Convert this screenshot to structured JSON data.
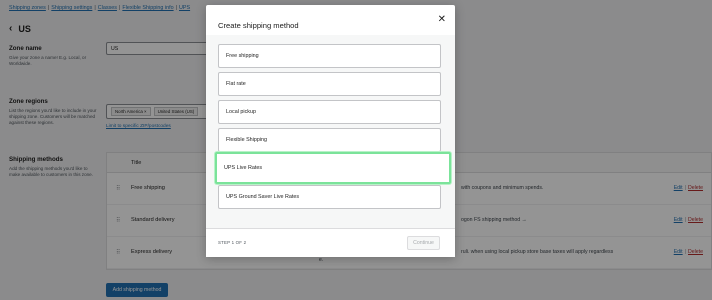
{
  "breadcrumb": {
    "items": [
      "Shipping zones",
      "Shipping settings",
      "Classes",
      "Flexible Shipping info",
      "UPS"
    ],
    "separator": "|"
  },
  "zone": {
    "back_title": "US",
    "name_section": {
      "title": "Zone name",
      "description": "Give your zone a name! E.g. Local, or Worldwide.",
      "value": "US"
    },
    "regions_section": {
      "title": "Zone regions",
      "description": "List the regions you'd like to include in your shipping zone. Customers will be matched against these regions.",
      "chips": [
        "North America ×",
        "United States (US)"
      ],
      "limit_link": "Limit to specific ZIP/postcodes"
    },
    "methods_section": {
      "title": "Shipping methods",
      "description": "Add the shipping methods you'd like to make available to customers in this zone.",
      "column_title": "Title",
      "rows": [
        {
          "name": "Free shipping",
          "desc": "with coupons and minimum spends.",
          "desc2": ""
        },
        {
          "name": "Standard delivery",
          "desc": "ogon FS shipping method →",
          "desc2": ""
        },
        {
          "name": "Express delivery",
          "desc": "ruli. when using local pickup store base taxes will apply regardless",
          "desc2": "e."
        }
      ],
      "edit_label": "Edit",
      "delete_label": "Delete",
      "add_button": "Add shipping method"
    }
  },
  "modal": {
    "title": "Create shipping method",
    "close_icon": "close-icon",
    "options": [
      "Free shipping",
      "Flat rate",
      "Local pickup",
      "Flexible Shipping",
      "UPS Live Rates",
      "UPS Ground Saver Live Rates"
    ],
    "highlighted_option": "UPS Live Rates",
    "step_label": "STEP 1 OF 2",
    "continue_label": "Continue"
  },
  "colors": {
    "accent": "#2271b1",
    "highlight_border": "#7be39a",
    "delete": "#b32d2e"
  }
}
